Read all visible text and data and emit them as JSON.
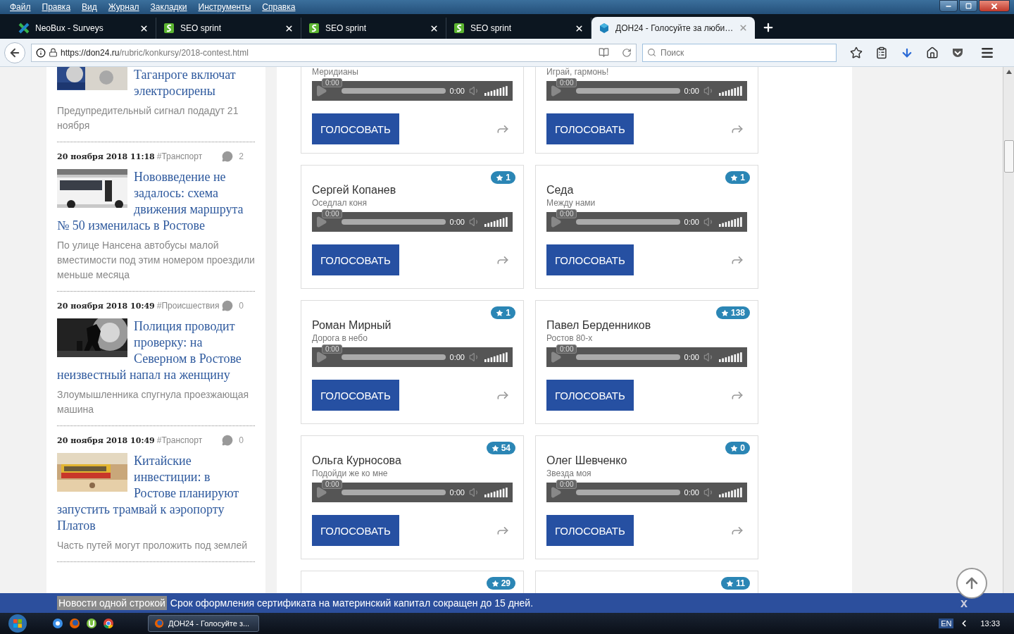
{
  "menu_bar": [
    {
      "label": "Файл"
    },
    {
      "label": "Правка"
    },
    {
      "label": "Вид"
    },
    {
      "label": "Журнал"
    },
    {
      "label": "Закладки"
    },
    {
      "label": "Инструменты"
    },
    {
      "label": "Справка"
    }
  ],
  "tabs": [
    {
      "kind": "neobux",
      "title": "NeoBux - Surveys",
      "selected": false
    },
    {
      "kind": "seo",
      "title": "SEO sprint",
      "selected": false
    },
    {
      "kind": "seo",
      "title": "SEO sprint",
      "selected": false
    },
    {
      "kind": "seo",
      "title": "SEO sprint",
      "selected": false
    },
    {
      "kind": "don24",
      "title": "ДОН24 - Голосуйте за люби…",
      "selected": true
    }
  ],
  "address_bar": {
    "host": "https://don24.ru",
    "path": "/rubric/konkursy/2018-contest.html"
  },
  "search": {
    "placeholder": "Поиск"
  },
  "news": [
    {
      "title": "Таганроге включат электросирены",
      "excerpt": "Предупредительный сигнал подадут 21 ноября"
    },
    {
      "date": "20 ноября 2018 11:18",
      "tag": "#Транспорт",
      "comments": "2",
      "title": "Нововведение не задалось: схема движения маршрута № 50 изменилась в Ростове",
      "excerpt": "По улице Нансена автобусы малой вместимости под этим номером проездили меньше месяца"
    },
    {
      "date": "20 ноября 2018 10:49",
      "tag": "#Происшествия",
      "comments": "0",
      "title": "Полиция проводит проверку: на Северном в Ростове неизвестный напал на женщину",
      "excerpt": "Злоумышленника спугнула проезжающая машина"
    },
    {
      "date": "20 ноября 2018 10:49",
      "tag": "#Транспорт",
      "comments": "0",
      "title": "Китайские инвестиции: в Ростове планируют запустить трамвай к аэропорту Платов",
      "excerpt": "Часть путей могут проложить под землей"
    }
  ],
  "contest_cards": [
    {
      "track": "Меридианы",
      "tooltip": "0:00",
      "time": "0:00",
      "button": "ГОЛОСОВАТЬ"
    },
    {
      "track": "Играй, гармонь!",
      "tooltip": "0:00",
      "time": "0:00",
      "button": "ГОЛОСОВАТЬ"
    },
    {
      "name": "Сергей Копанев",
      "votes": "1",
      "track": "Оседлал коня",
      "tooltip": "0:00",
      "time": "0:00",
      "button": "ГОЛОСОВАТЬ"
    },
    {
      "name": "Седа",
      "votes": "1",
      "track": "Между нами",
      "tooltip": "0:00",
      "time": "0:00",
      "button": "ГОЛОСОВАТЬ"
    },
    {
      "name": "Роман Мирный",
      "votes": "1",
      "track": "Дорога в небо",
      "tooltip": "0:00",
      "time": "0:00",
      "button": "ГОЛОСОВАТЬ"
    },
    {
      "name": "Павел Берденников",
      "votes": "138",
      "track": "Ростов 80-х",
      "tooltip": "0:00",
      "time": "0:00",
      "button": "ГОЛОСОВАТЬ"
    },
    {
      "name": "Ольга Курносова",
      "votes": "54",
      "track": "Подойди же ко мне",
      "tooltip": "0:00",
      "time": "0:00",
      "button": "ГОЛОСОВАТЬ"
    },
    {
      "name": "Олег Шевченко",
      "votes": "0",
      "track": "Звезда моя",
      "tooltip": "0:00",
      "time": "0:00",
      "button": "ГОЛОСОВАТЬ"
    },
    {
      "votes": "29"
    },
    {
      "votes": "11"
    }
  ],
  "ticker": {
    "label": "Новости одной строкой",
    "text": "Срок оформления сертификата на материнский капитал сокращен до 15 дней.",
    "close": "x"
  },
  "taskbar": {
    "window": "ДОН24 - Голосуйте з...",
    "language": "EN",
    "clock": "13:33"
  }
}
